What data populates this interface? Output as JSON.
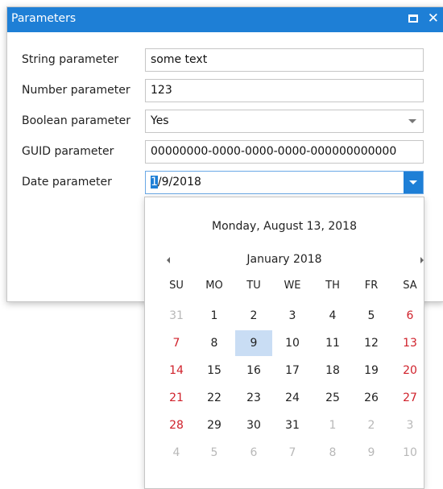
{
  "window": {
    "title": "Parameters"
  },
  "params": [
    {
      "label": "String parameter",
      "value": "some text"
    },
    {
      "label": "Number parameter",
      "value": "123"
    },
    {
      "label": "Boolean parameter",
      "value": "Yes"
    },
    {
      "label": "GUID parameter",
      "value": "00000000-0000-0000-0000-000000000000"
    },
    {
      "label": "Date parameter",
      "value_selected": "1",
      "value_rest": "/9/2018"
    }
  ],
  "calendar": {
    "today_text": "Monday, August 13, 2018",
    "month_title": "January 2018",
    "weekdays": [
      "SU",
      "MO",
      "TU",
      "WE",
      "TH",
      "FR",
      "SA"
    ],
    "weeks": [
      [
        {
          "d": "31",
          "o": true
        },
        {
          "d": "1"
        },
        {
          "d": "2"
        },
        {
          "d": "3"
        },
        {
          "d": "4"
        },
        {
          "d": "5"
        },
        {
          "d": "6"
        }
      ],
      [
        {
          "d": "7"
        },
        {
          "d": "8"
        },
        {
          "d": "9",
          "sel": true
        },
        {
          "d": "10"
        },
        {
          "d": "11"
        },
        {
          "d": "12"
        },
        {
          "d": "13"
        }
      ],
      [
        {
          "d": "14"
        },
        {
          "d": "15"
        },
        {
          "d": "16"
        },
        {
          "d": "17"
        },
        {
          "d": "18"
        },
        {
          "d": "19"
        },
        {
          "d": "20"
        }
      ],
      [
        {
          "d": "21"
        },
        {
          "d": "22"
        },
        {
          "d": "23"
        },
        {
          "d": "24"
        },
        {
          "d": "25"
        },
        {
          "d": "26"
        },
        {
          "d": "27"
        }
      ],
      [
        {
          "d": "28"
        },
        {
          "d": "29"
        },
        {
          "d": "30"
        },
        {
          "d": "31"
        },
        {
          "d": "1",
          "o": true
        },
        {
          "d": "2",
          "o": true
        },
        {
          "d": "3",
          "o": true
        }
      ],
      [
        {
          "d": "4",
          "o": true
        },
        {
          "d": "5",
          "o": true
        },
        {
          "d": "6",
          "o": true
        },
        {
          "d": "7",
          "o": true
        },
        {
          "d": "8",
          "o": true
        },
        {
          "d": "9",
          "o": true
        },
        {
          "d": "10",
          "o": true
        }
      ]
    ]
  },
  "colors": {
    "accent": "#1e7fd6",
    "weekend": "#d0212b",
    "other_month": "#b8b8b8",
    "selected_day": "#c9ddf4"
  }
}
